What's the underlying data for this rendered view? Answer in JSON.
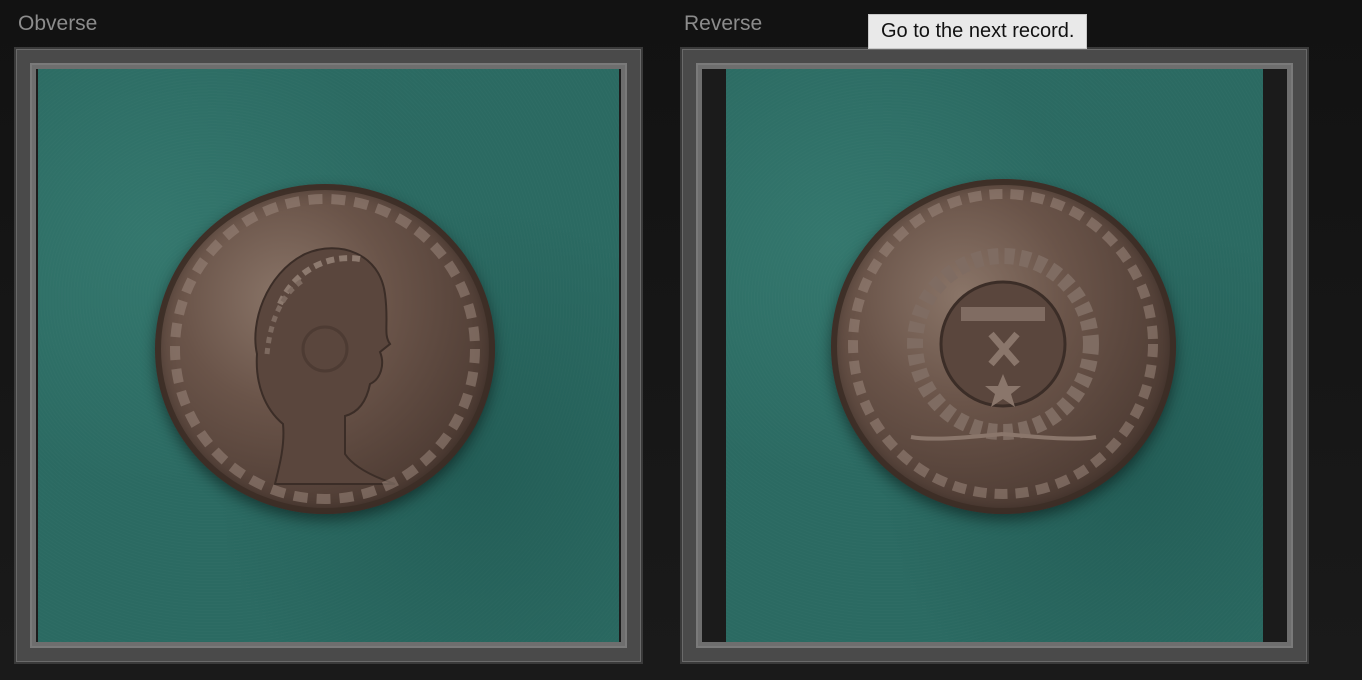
{
  "panels": {
    "obverse": {
      "label": "Obverse",
      "image_subject": "coin-obverse-portrait"
    },
    "reverse": {
      "label": "Reverse",
      "image_subject": "coin-reverse-wreath"
    }
  },
  "tooltip": {
    "text": "Go to the next record."
  },
  "colors": {
    "background": "#111111",
    "label": "#8c8c8c",
    "frame": "#4a4a4a",
    "felt": "#2b6a62",
    "coin": "#6a5449",
    "tooltip_bg": "#e9e9e9"
  }
}
